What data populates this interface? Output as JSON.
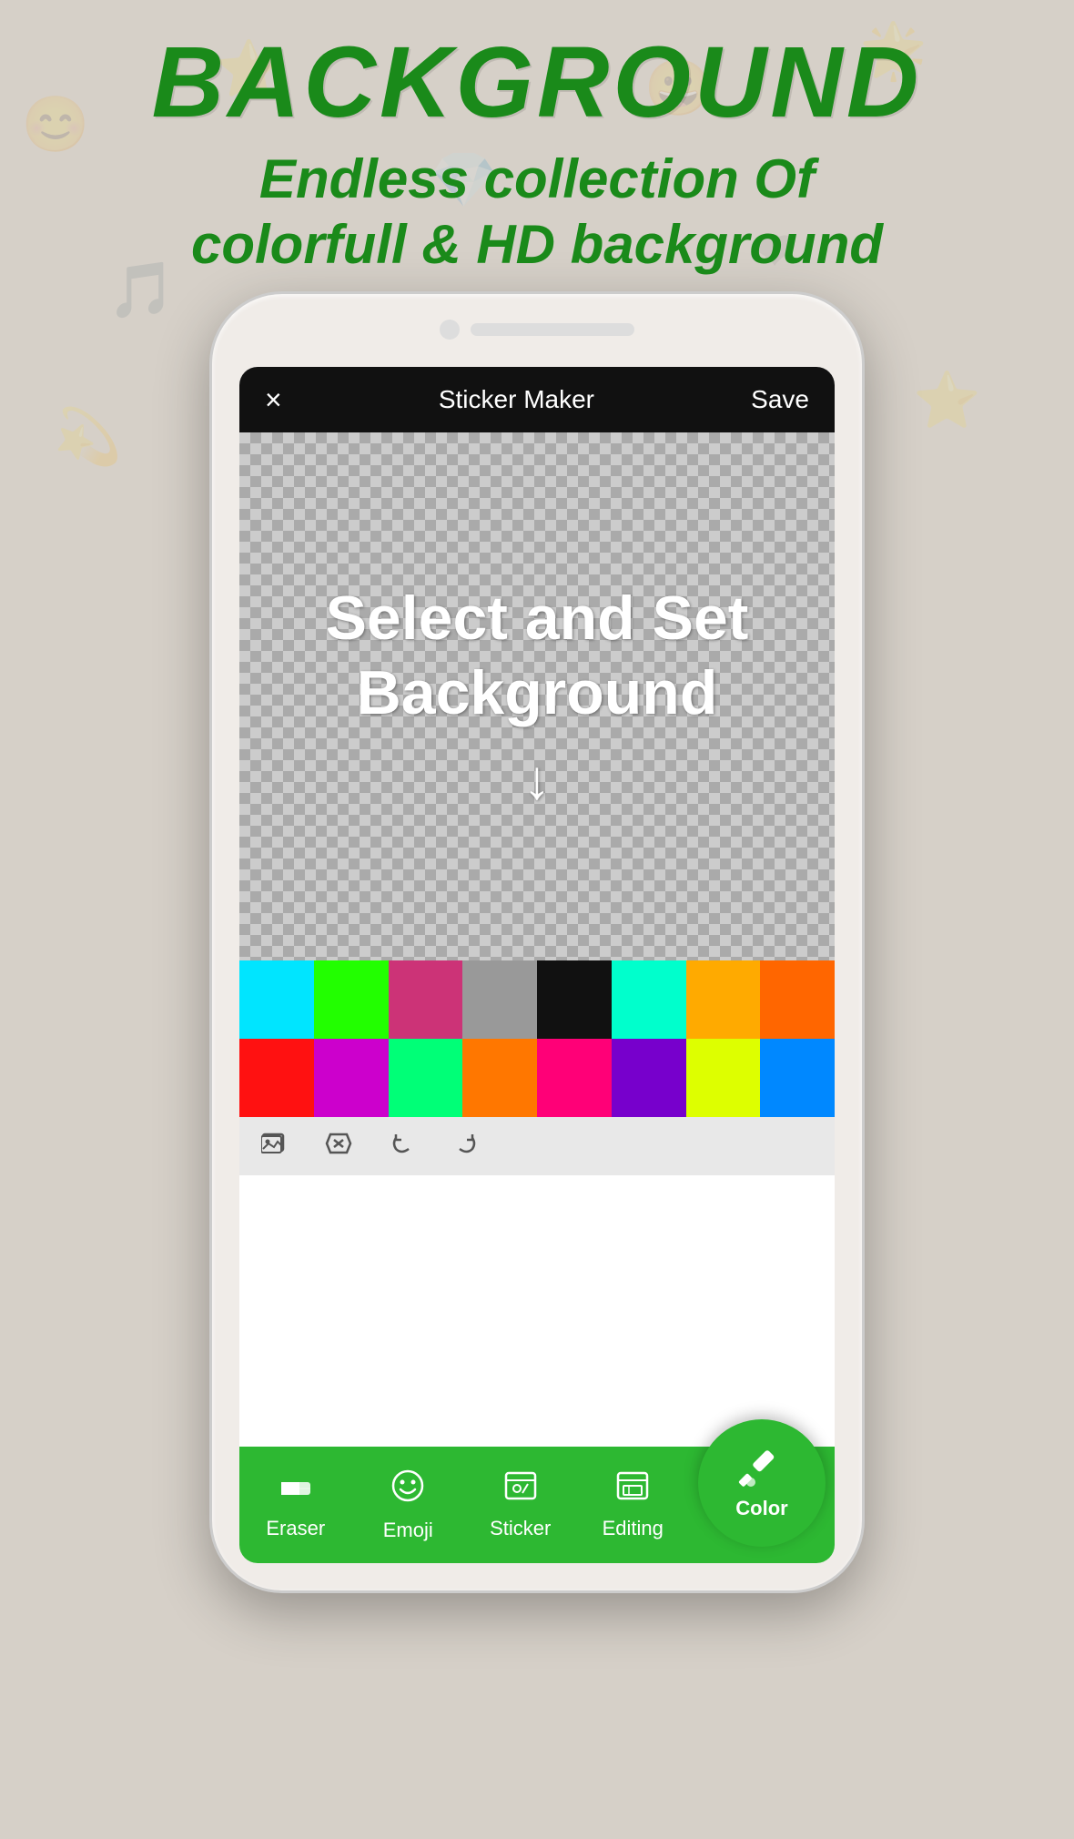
{
  "page": {
    "background_color": "#d6d0c8"
  },
  "top": {
    "main_title": "BACKGROUND",
    "subtitle_line1": "Endless collection Of",
    "subtitle_line2": "colorfull & HD background"
  },
  "app": {
    "header": {
      "close_label": "×",
      "title": "Sticker Maker",
      "save_label": "Save"
    },
    "canvas": {
      "text_line1": "Select and Set",
      "text_line2": "Background"
    },
    "color_palette": {
      "row1": [
        "#00e5ff",
        "#22ff00",
        "#cc3377",
        "#999999",
        "#111111",
        "#00ffcc",
        "#ffaa00",
        "#ff6600"
      ],
      "row2": [
        "#ff1111",
        "#cc00cc",
        "#00ff77",
        "#ff7700",
        "#ff0077",
        "#7700cc",
        "#ddff00",
        "#0088ff"
      ]
    },
    "toolbar": {
      "icons": [
        "gallery",
        "no-sign",
        "undo",
        "redo"
      ]
    },
    "bottom_nav": {
      "items": [
        {
          "id": "eraser",
          "label": "Eraser",
          "icon": "✏"
        },
        {
          "id": "emoji",
          "label": "Emoji",
          "icon": "😊"
        },
        {
          "id": "sticker",
          "label": "Sticker",
          "icon": "🖼"
        },
        {
          "id": "editing",
          "label": "Editing",
          "icon": "🖼"
        }
      ],
      "color_fab_label": "Color"
    }
  }
}
